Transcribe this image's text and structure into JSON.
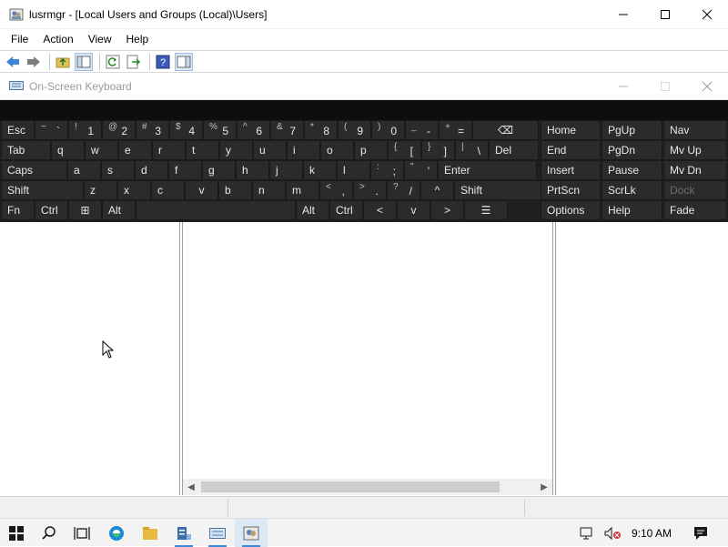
{
  "window": {
    "title": "lusrmgr - [Local Users and Groups (Local)\\Users]"
  },
  "menu": [
    "File",
    "Action",
    "View",
    "Help"
  ],
  "osk": {
    "title": "On-Screen Keyboard",
    "rows": [
      [
        {
          "label": "Esc"
        },
        {
          "sm": "~",
          "big": "`"
        },
        {
          "sm": "!",
          "big": "1"
        },
        {
          "sm": "@",
          "big": "2"
        },
        {
          "sm": "#",
          "big": "3"
        },
        {
          "sm": "$",
          "big": "4"
        },
        {
          "sm": "%",
          "big": "5"
        },
        {
          "sm": "^",
          "big": "6"
        },
        {
          "sm": "&",
          "big": "7"
        },
        {
          "sm": "*",
          "big": "8"
        },
        {
          "sm": "(",
          "big": "9"
        },
        {
          "sm": ")",
          "big": "0"
        },
        {
          "sm": "_",
          "big": "-"
        },
        {
          "sm": "+",
          "big": "="
        },
        {
          "label": "⌫"
        }
      ],
      [
        {
          "label": "Tab"
        },
        {
          "label": "q"
        },
        {
          "label": "w"
        },
        {
          "label": "e"
        },
        {
          "label": "r"
        },
        {
          "label": "t"
        },
        {
          "label": "y"
        },
        {
          "label": "u"
        },
        {
          "label": "i"
        },
        {
          "label": "o"
        },
        {
          "label": "p"
        },
        {
          "sm": "{",
          "big": "["
        },
        {
          "sm": "}",
          "big": "]"
        },
        {
          "sm": "|",
          "big": "\\"
        },
        {
          "label": "Del"
        }
      ],
      [
        {
          "label": "Caps"
        },
        {
          "label": "a"
        },
        {
          "label": "s"
        },
        {
          "label": "d"
        },
        {
          "label": "f"
        },
        {
          "label": "g"
        },
        {
          "label": "h"
        },
        {
          "label": "j"
        },
        {
          "label": "k"
        },
        {
          "label": "l"
        },
        {
          "sm": ":",
          "big": ";"
        },
        {
          "sm": "\"",
          "big": "'"
        },
        {
          "label": "Enter"
        }
      ],
      [
        {
          "label": "Shift"
        },
        {
          "label": "z"
        },
        {
          "label": "x"
        },
        {
          "label": "c"
        },
        {
          "label": "v"
        },
        {
          "label": "b"
        },
        {
          "label": "n"
        },
        {
          "label": "m"
        },
        {
          "sm": "<",
          "big": ","
        },
        {
          "sm": ">",
          "big": "."
        },
        {
          "sm": "?",
          "big": "/"
        },
        {
          "label": "^"
        },
        {
          "label": "Shift"
        }
      ],
      [
        {
          "label": "Fn"
        },
        {
          "label": "Ctrl"
        },
        {
          "label": "⊞"
        },
        {
          "label": "Alt"
        },
        {
          "label": ""
        },
        {
          "label": "Alt"
        },
        {
          "label": "Ctrl"
        },
        {
          "label": "<"
        },
        {
          "label": "v"
        },
        {
          "label": ">"
        },
        {
          "label": "☰"
        }
      ]
    ],
    "nav": [
      [
        "Home",
        "PgUp",
        "Nav"
      ],
      [
        "End",
        "PgDn",
        "Mv Up"
      ],
      [
        "Insert",
        "Pause",
        "Mv Dn"
      ],
      [
        "PrtScn",
        "ScrLk",
        "Dock"
      ],
      [
        "Options",
        "Help",
        "Fade"
      ]
    ]
  },
  "taskbar": {
    "time": "9:10 AM"
  }
}
